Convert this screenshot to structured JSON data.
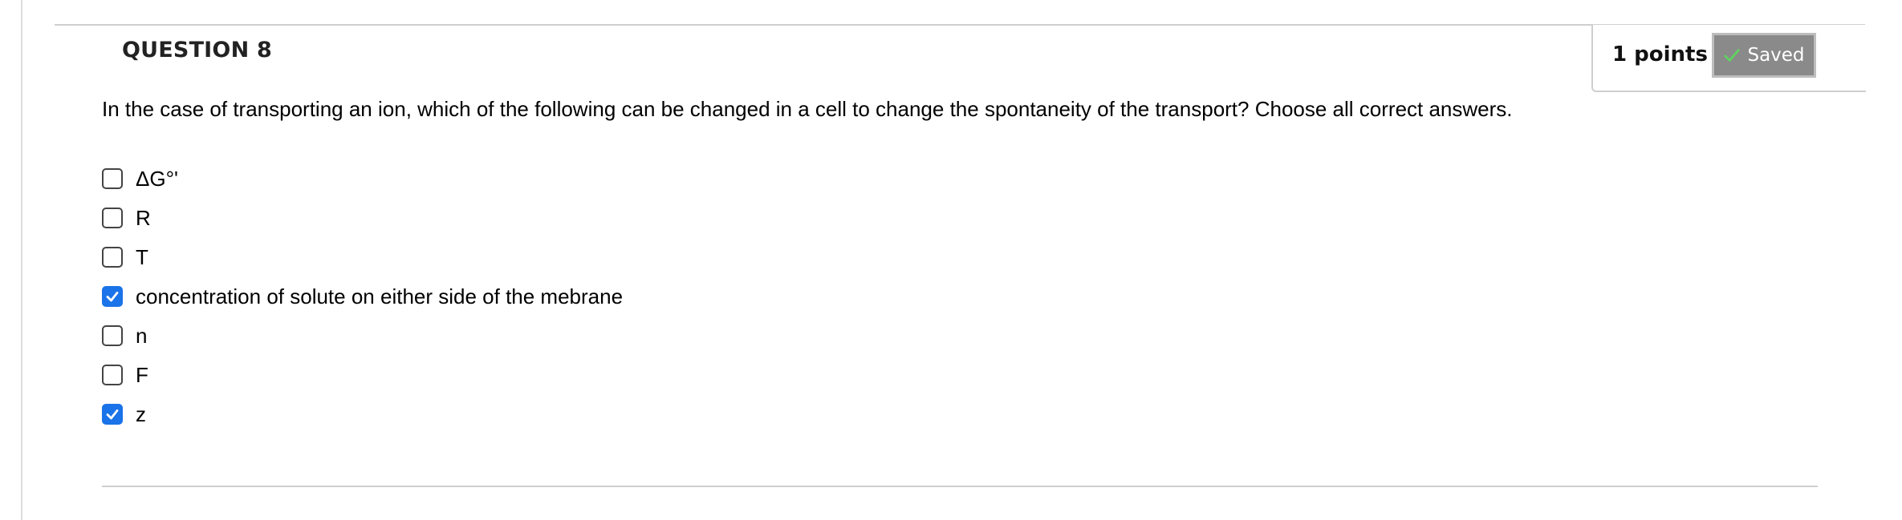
{
  "question": {
    "title": "QUESTION 8",
    "points_label": "1 points",
    "saved_label": "Saved",
    "saved_icon": "check-icon",
    "text": "In the case of transporting an ion, which of the following can be changed in a cell to change the spontaneity of the transport? Choose all correct answers.",
    "options": [
      {
        "label": "ΔG°'",
        "checked": false
      },
      {
        "label": "R",
        "checked": false
      },
      {
        "label": "T",
        "checked": false
      },
      {
        "label": "concentration of solute on either side of the mebrane",
        "checked": true
      },
      {
        "label": "n",
        "checked": false
      },
      {
        "label": "F",
        "checked": false
      },
      {
        "label": "z",
        "checked": true
      }
    ]
  },
  "colors": {
    "checkbox_checked": "#1a73e8",
    "saved_button_bg": "#8a8a8a",
    "saved_check": "#5fd35f",
    "rule": "#cfcfcf"
  }
}
